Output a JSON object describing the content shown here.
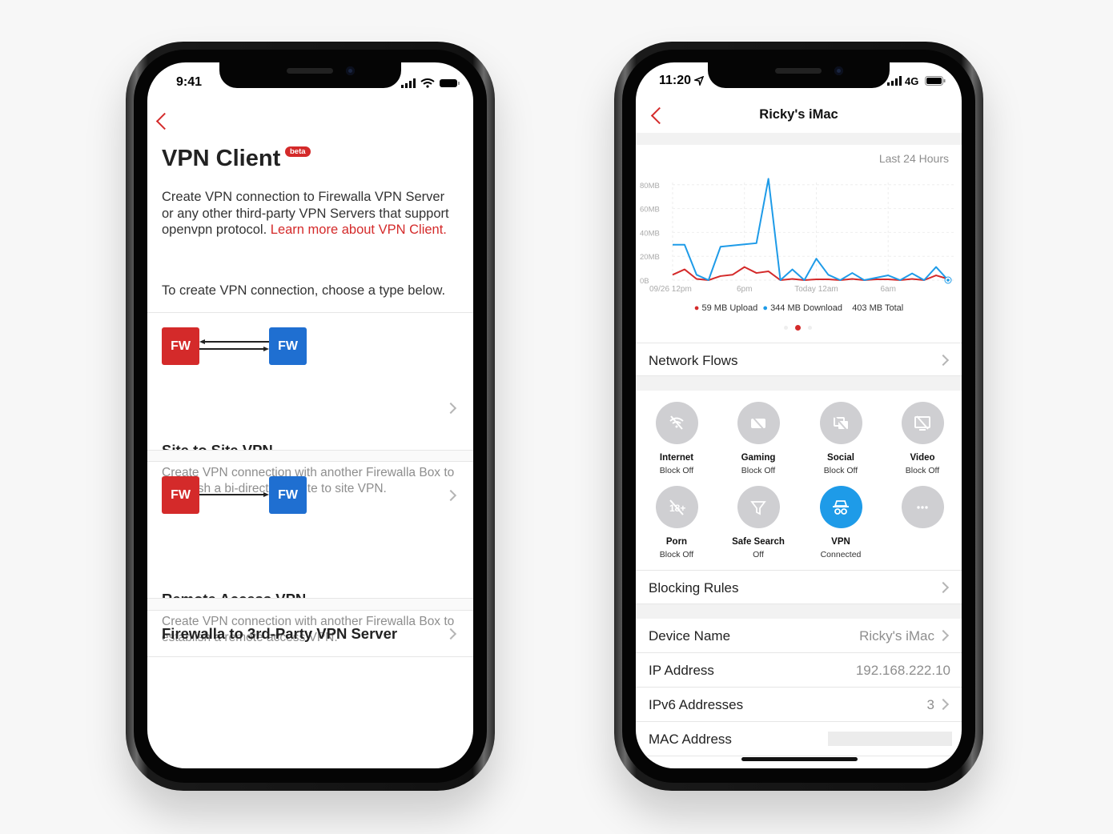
{
  "left_phone": {
    "status": {
      "time": "9:41"
    },
    "title": "VPN Client",
    "badge": "beta",
    "description": "Create VPN connection to Firewalla VPN Server or any other third-party VPN Servers that support openvpn protocol. ",
    "learn_more_link": "Learn more about VPN Client.",
    "instruction": "To create VPN connection, choose a type below.",
    "options": [
      {
        "box_a": "FW",
        "box_b": "FW",
        "title": "Site to Site VPN",
        "description": "Create VPN connection with another Firewalla Box to establish a bi-directional site to site VPN."
      },
      {
        "box_a": "FW",
        "box_b": "FW",
        "title": "Remote Access VPN",
        "description": "Create VPN connection with another Firewalla Box to establish a remote access VPN."
      },
      {
        "title": "Firewalla to 3rd-Party VPN Server"
      }
    ],
    "colors": {
      "accent": "#d42a2a",
      "fw_red": "#d42a2a",
      "fw_blue": "#1f6fd1"
    }
  },
  "right_phone": {
    "status": {
      "time": "11:20",
      "network": "4G"
    },
    "title": "Ricky's iMac",
    "range": "Last 24 Hours",
    "legend": {
      "upload": "59 MB Upload",
      "download": "344 MB Download",
      "total": "403 MB Total"
    },
    "network_flows": "Network Flows",
    "tiles": [
      {
        "icon": "internet-off-icon",
        "title": "Internet",
        "status": "Block Off",
        "active": false
      },
      {
        "icon": "gaming-off-icon",
        "title": "Gaming",
        "status": "Block Off",
        "active": false
      },
      {
        "icon": "social-off-icon",
        "title": "Social",
        "status": "Block Off",
        "active": false
      },
      {
        "icon": "video-off-icon",
        "title": "Video",
        "status": "Block Off",
        "active": false
      },
      {
        "icon": "porn-off-icon",
        "title": "Porn",
        "status": "Block Off",
        "active": false
      },
      {
        "icon": "filter-icon",
        "title": "Safe Search",
        "status": "Off",
        "active": false
      },
      {
        "icon": "incognito-icon",
        "title": "VPN",
        "status": "Connected",
        "active": true
      },
      {
        "icon": "more-icon",
        "title": "",
        "status": "",
        "active": false
      }
    ],
    "blocking_rules": "Blocking Rules",
    "details": [
      {
        "label": "Device Name",
        "value": "Ricky's iMac",
        "chevron": true
      },
      {
        "label": "IP Address",
        "value": "192.168.222.10",
        "chevron": false
      },
      {
        "label": "IPv6 Addresses",
        "value": "3",
        "chevron": true
      },
      {
        "label": "MAC Address",
        "value": "",
        "chevron": false
      }
    ],
    "colors": {
      "upload": "#d42a2a",
      "download": "#1e9be8",
      "vpn_active": "#1e9be8"
    }
  },
  "chart_data": {
    "type": "line",
    "title": "",
    "xlabel": "",
    "ylabel": "",
    "ylim": [
      0,
      85
    ],
    "yticks": [
      "0B",
      "20MB",
      "40MB",
      "60MB",
      "80MB"
    ],
    "ytick_values": [
      0,
      20,
      40,
      60,
      80
    ],
    "xticks": [
      {
        "index": 0,
        "label": "09/26 12pm"
      },
      {
        "index": 6,
        "label": "6pm"
      },
      {
        "index": 12,
        "label": "Today 12am"
      },
      {
        "index": 18,
        "label": "6am"
      }
    ],
    "grid": true,
    "series": [
      {
        "name": "Upload",
        "color": "#d42a2a",
        "values": [
          4.5,
          9,
          1,
          0,
          3.4,
          4.5,
          11,
          6,
          7.4,
          0,
          1,
          0,
          0.7,
          0.7,
          0,
          1,
          0,
          0.7,
          0.7,
          0,
          1,
          0,
          4,
          1
        ]
      },
      {
        "name": "Download",
        "color": "#1e9be8",
        "values": [
          29.7,
          29.7,
          4.5,
          0,
          28,
          29,
          30,
          31,
          85,
          0,
          9,
          0,
          18,
          4.5,
          0,
          6,
          0,
          2,
          4,
          0,
          5.6,
          0,
          11,
          0
        ]
      }
    ]
  }
}
